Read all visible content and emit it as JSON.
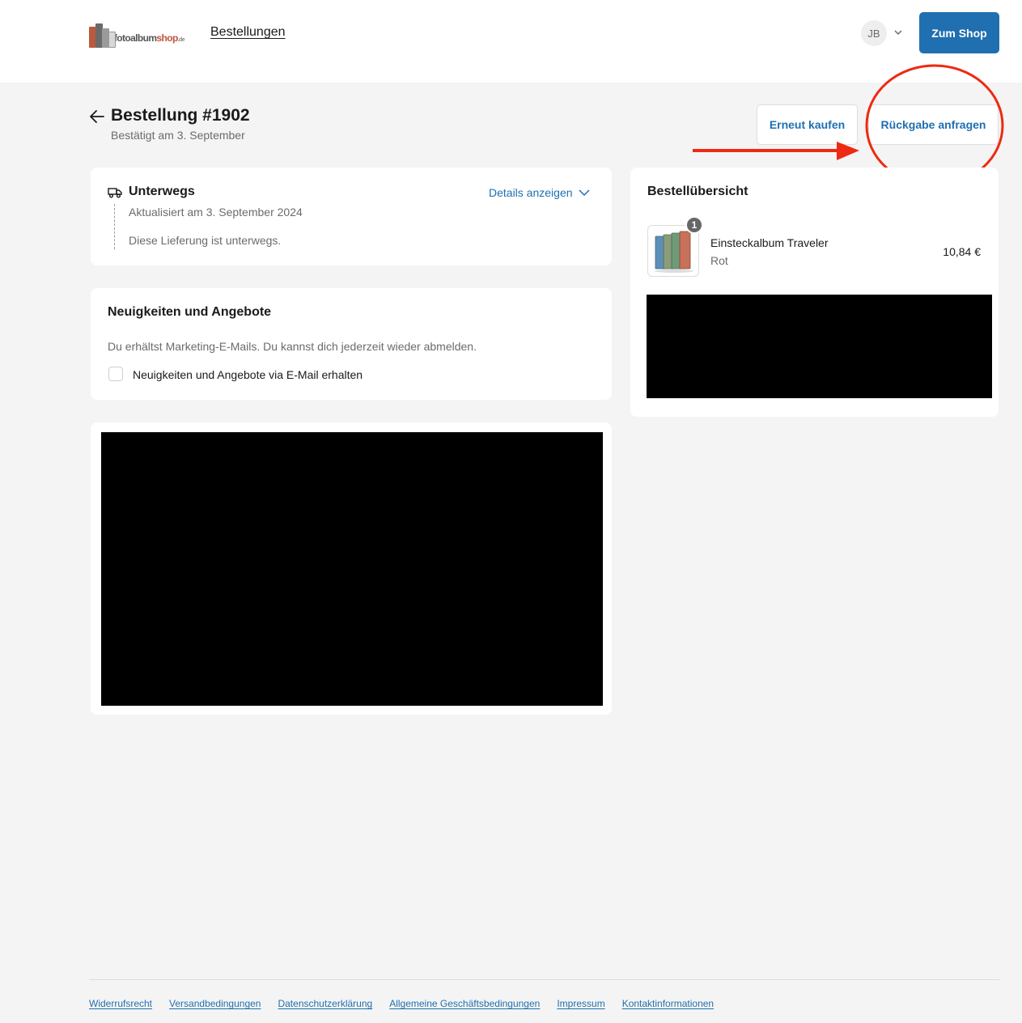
{
  "header": {
    "logo": {
      "part1": "fotoalbum",
      "part2": "shop",
      "part3": ".de"
    },
    "nav_link": "Bestellungen",
    "avatar_initials": "JB",
    "shop_button": "Zum Shop"
  },
  "order": {
    "title": "Bestellung #1902",
    "subtitle": "Bestätigt am 3. September",
    "rebuy_button": "Erneut kaufen",
    "return_button": "Rückgabe anfragen"
  },
  "status_card": {
    "title": "Unterwegs",
    "updated": "Aktualisiert am 3. September 2024",
    "message": "Diese Lieferung ist unterwegs.",
    "details_link": "Details anzeigen"
  },
  "news_card": {
    "title": "Neuigkeiten und Angebote",
    "text": "Du erhältst Marketing-E-Mails. Du kannst dich jederzeit wieder abmelden.",
    "checkbox_label": "Neuigkeiten und Angebote via E-Mail erhalten",
    "checkbox_checked": false
  },
  "summary": {
    "title": "Bestellübersicht",
    "items": [
      {
        "name": "Einsteckalbum Traveler",
        "variant": "Rot",
        "price": "10,84 €",
        "quantity": "1"
      }
    ]
  },
  "footer": {
    "links": [
      "Widerrufsrecht",
      "Versandbedingungen",
      "Datenschutzerklärung",
      "Allgemeine Geschäftsbedingungen",
      "Impressum",
      "Kontaktinformationen"
    ]
  },
  "colors": {
    "accent": "#1f6fb1",
    "annotation": "#ee2a12",
    "background": "#f4f4f4"
  }
}
